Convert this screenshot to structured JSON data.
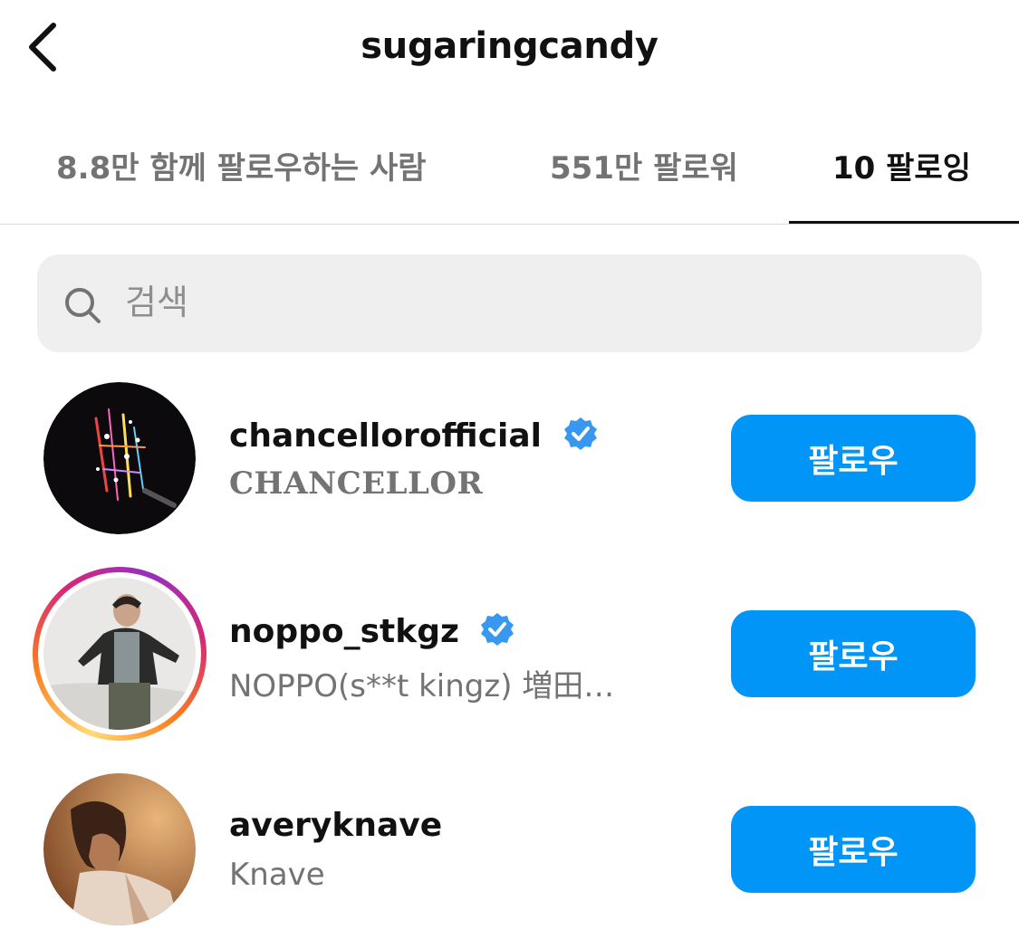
{
  "header": {
    "title": "sugaringcandy",
    "back_icon": "chevron-left-icon"
  },
  "tabs": [
    {
      "label": "8.8만 함께 팔로우하는 사람",
      "active": false
    },
    {
      "label": "551만 팔로워",
      "active": false
    },
    {
      "label": "10 팔로잉",
      "active": true
    }
  ],
  "search": {
    "placeholder": "검색",
    "value": "",
    "icon": "search-icon"
  },
  "users": [
    {
      "username": "chancellorofficial",
      "full_name": "CHANCELLOR",
      "verified": true,
      "story": false,
      "button_label": "팔로우"
    },
    {
      "username": "noppo_stkgz",
      "full_name": "NOPPO(s**t kingz) 増田…",
      "verified": true,
      "story": true,
      "button_label": "팔로우"
    },
    {
      "username": "averyknave",
      "full_name": "Knave",
      "verified": false,
      "story": false,
      "button_label": "팔로우"
    }
  ],
  "colors": {
    "accent": "#0095f6",
    "verified": "#3897f0",
    "secondary_text": "#737373",
    "search_bg": "#efefef"
  }
}
